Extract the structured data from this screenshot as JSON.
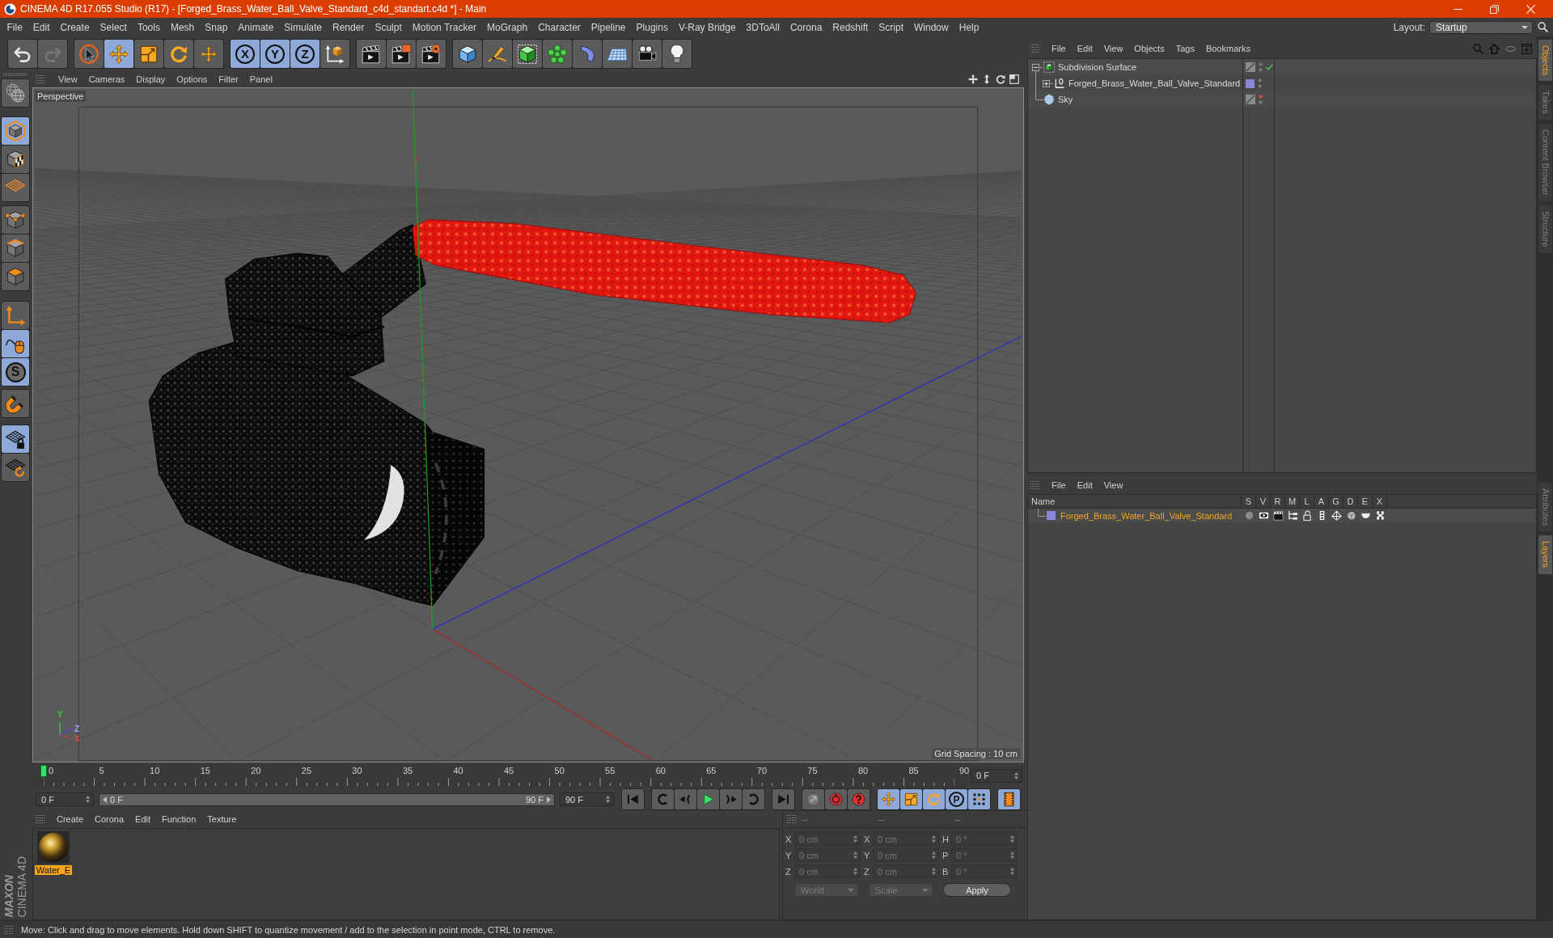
{
  "window": {
    "title": "CINEMA 4D R17.055 Studio (R17) - [Forged_Brass_Water_Ball_Valve_Standard_c4d_standart.c4d *] - Main"
  },
  "menu_bar": {
    "items": [
      "File",
      "Edit",
      "Create",
      "Select",
      "Tools",
      "Mesh",
      "Snap",
      "Animate",
      "Simulate",
      "Render",
      "Sculpt",
      "Motion Tracker",
      "MoGraph",
      "Character",
      "Pipeline",
      "Plugins",
      "V-Ray Bridge",
      "3DToAll",
      "Corona",
      "Redshift",
      "Script",
      "Window",
      "Help"
    ],
    "layout_label": "Layout:",
    "layout_value": "Startup"
  },
  "toolbar": {
    "groups": [
      [
        {
          "kind": "undo",
          "selected": false,
          "disabled": false
        },
        {
          "kind": "redo",
          "selected": false,
          "disabled": true
        }
      ],
      [
        {
          "kind": "select",
          "selected": false,
          "disabled": false
        },
        {
          "kind": "move",
          "selected": true,
          "disabled": false
        },
        {
          "kind": "scale",
          "selected": false,
          "disabled": false
        },
        {
          "kind": "rotate",
          "selected": false,
          "disabled": false
        },
        {
          "kind": "transform",
          "selected": false,
          "disabled": false
        }
      ],
      [
        {
          "kind": "axis-lock",
          "label": "X",
          "selected": true,
          "disabled": false
        },
        {
          "kind": "axis-lock",
          "label": "Y",
          "selected": true,
          "disabled": false
        },
        {
          "kind": "axis-lock",
          "label": "Z",
          "selected": true,
          "disabled": false
        },
        {
          "kind": "coordinate-system",
          "selected": false,
          "disabled": false
        }
      ],
      [
        {
          "kind": "render-view",
          "selected": false,
          "disabled": false
        },
        {
          "kind": "render-picture",
          "selected": false,
          "disabled": false
        },
        {
          "kind": "render-settings",
          "selected": false,
          "disabled": false
        }
      ],
      [
        {
          "kind": "cube",
          "selected": false,
          "disabled": false
        },
        {
          "kind": "pen",
          "selected": false,
          "disabled": false
        },
        {
          "kind": "subdivision",
          "selected": false,
          "disabled": false
        },
        {
          "kind": "cloner",
          "selected": false,
          "disabled": false
        },
        {
          "kind": "deformer",
          "selected": false,
          "disabled": false
        },
        {
          "kind": "floor",
          "selected": false,
          "disabled": false
        },
        {
          "kind": "camera",
          "selected": false,
          "disabled": false
        },
        {
          "kind": "light",
          "selected": false,
          "disabled": false
        }
      ]
    ]
  },
  "left_toolbar": {
    "groups": [
      [
        {
          "kind": "make-editable",
          "selected": false
        }
      ],
      [
        {
          "kind": "model",
          "selected": true
        },
        {
          "kind": "texture",
          "selected": false
        },
        {
          "kind": "workplane",
          "selected": false
        }
      ],
      [
        {
          "kind": "points",
          "selected": false
        },
        {
          "kind": "edges",
          "selected": false
        },
        {
          "kind": "polygons",
          "selected": false
        }
      ],
      [
        {
          "kind": "axis",
          "selected": false
        },
        {
          "kind": "tweak",
          "selected": true
        },
        {
          "kind": "solo",
          "label": "S",
          "selected": true
        }
      ],
      [
        {
          "kind": "snap",
          "selected": false
        }
      ],
      [
        {
          "kind": "workplane-lock",
          "selected": true
        },
        {
          "kind": "workplane-align",
          "selected": false
        }
      ]
    ],
    "branding": [
      "MAXON",
      "CINEMA 4D"
    ]
  },
  "viewport": {
    "menu": [
      "View",
      "Cameras",
      "Display",
      "Options",
      "Filter",
      "Panel"
    ],
    "camera": "Perspective",
    "grid_spacing": "Grid Spacing : 10 cm",
    "gizmo": [
      {
        "label": "Y",
        "color": "#3ad23a"
      },
      {
        "label": "Z",
        "color": "#9aa4ff"
      },
      {
        "label": "X",
        "color": "#e04848"
      }
    ]
  },
  "timeline": {
    "ticks": [
      "0",
      "5",
      "10",
      "15",
      "20",
      "25",
      "30",
      "35",
      "40",
      "45",
      "50",
      "55",
      "60",
      "65",
      "70",
      "75",
      "80",
      "85",
      "90"
    ],
    "level": 0,
    "current_frame": "0 F"
  },
  "transport": {
    "start_field": "0 F",
    "range_start": "0 F",
    "range_end": "90 F",
    "end_field": "90 F",
    "groups": [
      [
        {
          "kind": "first-frame",
          "selected": false
        }
      ],
      [
        {
          "kind": "previous-key",
          "selected": false
        },
        {
          "kind": "previous-frame",
          "selected": false
        },
        {
          "kind": "play",
          "selected": false
        },
        {
          "kind": "next-frame",
          "selected": false
        },
        {
          "kind": "next-key",
          "selected": false
        }
      ],
      [
        {
          "kind": "last-frame",
          "selected": false
        }
      ],
      [
        {
          "kind": "keyframe-selection",
          "selected": false
        },
        {
          "kind": "record",
          "selected": false
        },
        {
          "kind": "autokey",
          "selected": false
        }
      ],
      [
        {
          "kind": "key-position",
          "selected": true
        },
        {
          "kind": "key-scale",
          "selected": true
        },
        {
          "kind": "key-rotation",
          "selected": true
        },
        {
          "kind": "key-parameter",
          "label": "P",
          "selected": true
        },
        {
          "kind": "key-point-level",
          "selected": true
        }
      ],
      [
        {
          "kind": "scheme",
          "selected": true
        }
      ]
    ]
  },
  "material_manager": {
    "menu": [
      "Create",
      "Corona",
      "Edit",
      "Function",
      "Texture"
    ],
    "materials": [
      {
        "name": "Water_E",
        "selected": true
      }
    ]
  },
  "coordinates": {
    "headers": [
      "--",
      "--",
      "--"
    ],
    "disabled": true,
    "rows": [
      [
        {
          "axis": "X",
          "value": "0 cm"
        },
        {
          "axis": "X",
          "value": "0 cm"
        },
        {
          "axis": "H",
          "value": "0 °"
        }
      ],
      [
        {
          "axis": "Y",
          "value": "0 cm"
        },
        {
          "axis": "Y",
          "value": "0 cm"
        },
        {
          "axis": "P",
          "value": "0 °"
        }
      ],
      [
        {
          "axis": "Z",
          "value": "0 cm"
        },
        {
          "axis": "Z",
          "value": "0 cm"
        },
        {
          "axis": "B",
          "value": "0 °"
        }
      ]
    ],
    "mode": "World",
    "size_mode": "Scale",
    "apply": "Apply"
  },
  "object_manager": {
    "menu": [
      "File",
      "Edit",
      "View",
      "Objects",
      "Tags",
      "Bookmarks"
    ],
    "objects": [
      {
        "name": "Subdivision Surface",
        "kind": "subdivision",
        "expanded": true,
        "selected": false,
        "enabled": true,
        "hidden_in_editor": false,
        "hidden_in_render": false,
        "children": [
          {
            "name": "Forged_Brass_Water_Ball_Valve_Standard",
            "kind": "null",
            "expanded": false,
            "selected": false,
            "enabled": false,
            "color": "#8a87d8",
            "hidden_in_editor": false,
            "hidden_in_render": false
          }
        ]
      },
      {
        "name": "Sky",
        "kind": "sky",
        "selected": false,
        "enabled": false,
        "hidden_in_editor": true,
        "hidden_in_render": false
      }
    ]
  },
  "layer_manager": {
    "menu": [
      "File",
      "Edit",
      "View"
    ],
    "columns": [
      "Name",
      "S",
      "V",
      "R",
      "M",
      "L",
      "A",
      "G",
      "D",
      "E",
      "X"
    ],
    "layers": [
      {
        "name": "Forged_Brass_Water_Ball_Valve_Standard",
        "color": "#8a87d8",
        "selected": true
      }
    ]
  },
  "side_tabs": {
    "upper": [
      {
        "label": "Objects",
        "selected": true
      },
      {
        "label": "Takes",
        "selected": false
      },
      {
        "label": "Content Browser",
        "selected": false
      },
      {
        "label": "Structure",
        "selected": false
      }
    ],
    "lower": [
      {
        "label": "Attributes",
        "selected": false
      },
      {
        "label": "Layers",
        "selected": true
      }
    ]
  },
  "status_bar": {
    "text": "Move: Click and drag to move elements. Hold down SHIFT to quantize movement / add to the selection in point mode, CTRL to remove."
  }
}
